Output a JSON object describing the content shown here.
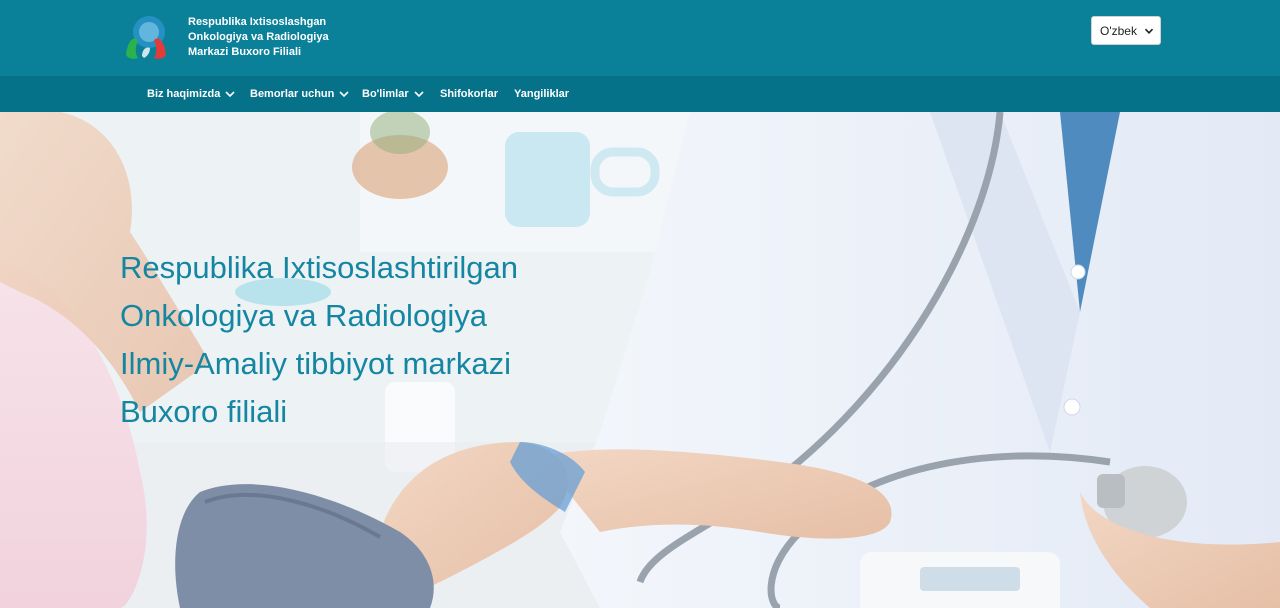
{
  "header": {
    "brand_lines": [
      "Respublika Ixtisoslashgan",
      "Onkologiya va Radiologiya",
      "Markazi Buxoro Filiali"
    ],
    "language": {
      "selected": "O'zbek"
    }
  },
  "nav": {
    "items": [
      {
        "label": "Biz haqimizda",
        "has_dropdown": true
      },
      {
        "label": "Bemorlar uchun",
        "has_dropdown": true
      },
      {
        "label": "Bo'limlar",
        "has_dropdown": true
      },
      {
        "label": "Shifokorlar",
        "has_dropdown": false
      },
      {
        "label": "Yangiliklar",
        "has_dropdown": false
      }
    ]
  },
  "hero": {
    "title_lines": [
      "Respublika Ixtisoslashtirilgan",
      "Onkologiya va Radiologiya",
      "Ilmiy-Amaliy tibbiyot markazi",
      "Buxoro filiali"
    ]
  },
  "colors": {
    "header_bg": "#0a8199",
    "nav_bg": "#06728a",
    "hero_text": "#1486a1"
  },
  "icons": {
    "logo": "hands-logo",
    "nav_chevron": "chevron-down-icon",
    "select_chevron": "chevron-down-icon"
  }
}
